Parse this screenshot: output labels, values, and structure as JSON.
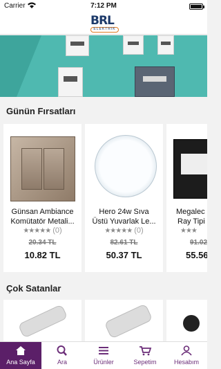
{
  "status_bar": {
    "carrier": "Carrier",
    "time": "7:12 PM",
    "battery_level": 0.9
  },
  "header": {
    "logo_text": "BRL",
    "logo_subtext": "ELEKTRIK"
  },
  "banner": {
    "slides": 3,
    "active_slide": 1
  },
  "sections": {
    "deals_title": "Günün Fırsatları",
    "bestsellers_title": "Çok Satanlar"
  },
  "deals": [
    {
      "name_line1": "Günsan Ambiance",
      "name_line2": "Komütatör Metali...",
      "stars": "★★★★★",
      "reviews": "(0)",
      "old_price": "20.34 TL",
      "price": "10.82 TL"
    },
    {
      "name_line1": "Hero 24w Sıva",
      "name_line2": "Üstü Yuvarlak Le...",
      "stars": "★★★★★",
      "reviews": "(0)",
      "old_price": "82.61 TL",
      "price": "50.37 TL"
    },
    {
      "name_line1": "Megalec",
      "name_line2": "Ray Tipi",
      "stars": "★★★",
      "reviews": "",
      "old_price": "91.02",
      "price": "55.56"
    }
  ],
  "tabbar": [
    {
      "label": "Ana Sayfa",
      "icon": "home-icon",
      "active": true
    },
    {
      "label": "Ara",
      "icon": "search-icon",
      "active": false
    },
    {
      "label": "Ürünler",
      "icon": "menu-icon",
      "active": false
    },
    {
      "label": "Sepetim",
      "icon": "cart-icon",
      "active": false
    },
    {
      "label": "Hesabım",
      "icon": "user-icon",
      "active": false
    }
  ],
  "colors": {
    "accent": "#5b1f68",
    "banner": "#4fb9b0",
    "logo_orange": "#e07a1f",
    "logo_blue": "#1d3a6a"
  }
}
